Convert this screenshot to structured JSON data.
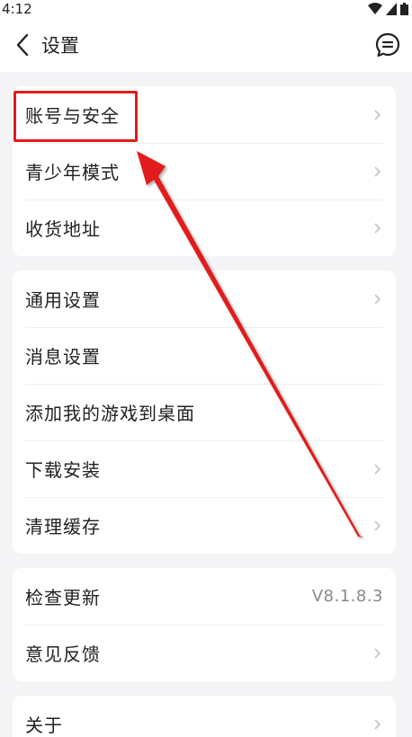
{
  "status": {
    "time": "4:12"
  },
  "header": {
    "title": "设置"
  },
  "groups": [
    [
      {
        "label": "账号与安全",
        "chevron": true
      },
      {
        "label": "青少年模式",
        "chevron": true
      },
      {
        "label": "收货地址",
        "chevron": true
      }
    ],
    [
      {
        "label": "通用设置",
        "chevron": true
      },
      {
        "label": "消息设置",
        "chevron": false
      },
      {
        "label": "添加我的游戏到桌面",
        "chevron": false
      },
      {
        "label": "下载安装",
        "chevron": true
      },
      {
        "label": "清理缓存",
        "chevron": true
      }
    ],
    [
      {
        "label": "检查更新",
        "value": "V8.1.8.3",
        "chevron": false
      },
      {
        "label": "意见反馈",
        "chevron": true
      }
    ],
    [
      {
        "label": "关于",
        "chevron": true
      }
    ]
  ],
  "colors": {
    "annotation": "#e21b1b",
    "background": "#f4f4f6"
  }
}
